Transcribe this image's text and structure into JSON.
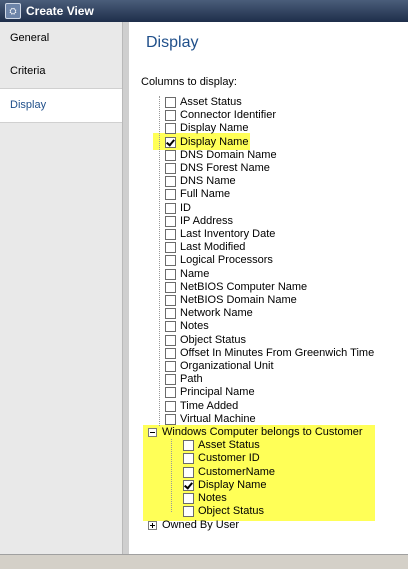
{
  "window": {
    "title": "Create View"
  },
  "nav": {
    "items": [
      "General",
      "Criteria",
      "Display"
    ],
    "active_index": 2
  },
  "main": {
    "title": "Display",
    "columns_label": "Columns to display:"
  },
  "columns": [
    {
      "label": "Asset Status",
      "checked": false
    },
    {
      "label": "Connector Identifier",
      "checked": false
    },
    {
      "label": "Display Name",
      "checked": false
    },
    {
      "label": "Display Name",
      "checked": true,
      "highlight": true
    },
    {
      "label": "DNS Domain Name",
      "checked": false
    },
    {
      "label": "DNS Forest Name",
      "checked": false
    },
    {
      "label": "DNS Name",
      "checked": false
    },
    {
      "label": "Full Name",
      "checked": false
    },
    {
      "label": "ID",
      "checked": false
    },
    {
      "label": "IP Address",
      "checked": false
    },
    {
      "label": "Last Inventory Date",
      "checked": false
    },
    {
      "label": "Last Modified",
      "checked": false
    },
    {
      "label": "Logical Processors",
      "checked": false
    },
    {
      "label": "Name",
      "checked": false
    },
    {
      "label": "NetBIOS Computer Name",
      "checked": false
    },
    {
      "label": "NetBIOS Domain Name",
      "checked": false
    },
    {
      "label": "Network Name",
      "checked": false
    },
    {
      "label": "Notes",
      "checked": false
    },
    {
      "label": "Object Status",
      "checked": false
    },
    {
      "label": "Offset In Minutes From Greenwich Time",
      "checked": false
    },
    {
      "label": "Organizational Unit",
      "checked": false
    },
    {
      "label": "Path",
      "checked": false
    },
    {
      "label": "Principal Name",
      "checked": false
    },
    {
      "label": "Time Added",
      "checked": false
    },
    {
      "label": "Virtual Machine",
      "checked": false
    }
  ],
  "group": {
    "label": "Windows Computer belongs to Customer",
    "expanded": true,
    "items": [
      {
        "label": "Asset Status",
        "checked": false
      },
      {
        "label": "Customer ID",
        "checked": false
      },
      {
        "label": "CustomerName",
        "checked": false
      },
      {
        "label": "Display Name",
        "checked": true
      },
      {
        "label": "Notes",
        "checked": false
      },
      {
        "label": "Object Status",
        "checked": false
      }
    ]
  },
  "collapsed_group": {
    "label": "Owned By User",
    "expanded": false
  },
  "colors": {
    "highlight": "#ffff57",
    "title_blue": "#1f4f8a"
  }
}
